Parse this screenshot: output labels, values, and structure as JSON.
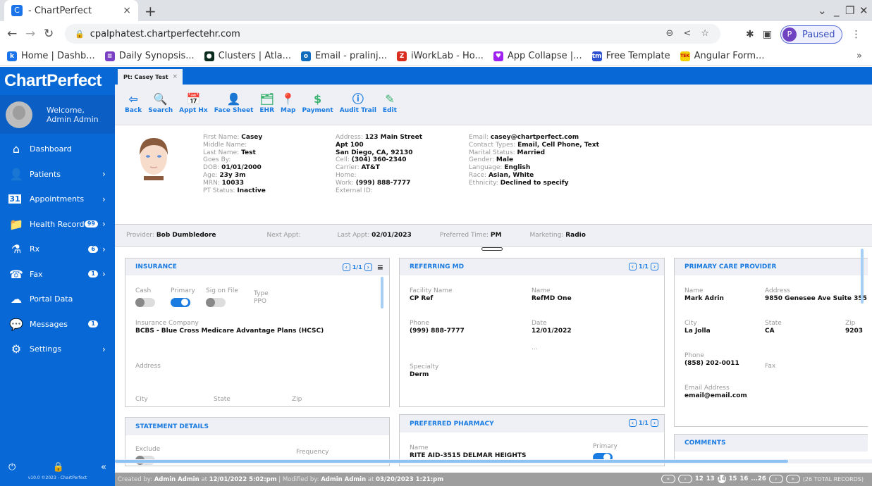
{
  "browser": {
    "tab_title": "- ChartPerfect",
    "url": "cpalphatest.chartperfectehr.com",
    "profile_label": "Paused",
    "profile_initial": "P",
    "bookmarks": [
      {
        "label": "Home | Dashb...",
        "color": "#1a73e8",
        "glyph": "k"
      },
      {
        "label": "Daily Synopsis...",
        "color": "#7b3fc4",
        "glyph": "≡"
      },
      {
        "label": "Clusters | Atla...",
        "color": "#0b2b1e",
        "glyph": "●"
      },
      {
        "label": "Email - pralinj...",
        "color": "#0f6cbd",
        "glyph": "o"
      },
      {
        "label": "iWorkLab - Ho...",
        "color": "#d92d20",
        "glyph": "Z"
      },
      {
        "label": "App Collapse |...",
        "color": "#a020f0",
        "glyph": "♥"
      },
      {
        "label": "Free Template",
        "color": "#2b4fcf",
        "glyph": "tm"
      },
      {
        "label": "Angular Form...",
        "color": "#f5d10a",
        "glyph": "TEK"
      }
    ]
  },
  "sidebar": {
    "brand": "ChartPerfect",
    "welcome_line1": "Welcome,",
    "welcome_line2": "Admin Admin",
    "items": [
      {
        "label": "Dashboard",
        "icon": "⌂",
        "badge": null,
        "chevron": false
      },
      {
        "label": "Patients",
        "icon": "👤",
        "badge": null,
        "chevron": true
      },
      {
        "label": "Appointments",
        "icon": "31",
        "badge": null,
        "chevron": true
      },
      {
        "label": "Health Record",
        "icon": "📁",
        "badge": "99",
        "chevron": true
      },
      {
        "label": "Rx",
        "icon": "⚗",
        "badge": "6",
        "chevron": true
      },
      {
        "label": "Fax",
        "icon": "☎",
        "badge": "1",
        "chevron": true
      },
      {
        "label": "Portal Data",
        "icon": "☁",
        "badge": null,
        "chevron": false
      },
      {
        "label": "Messages",
        "icon": "💬",
        "badge": "1",
        "chevron": false
      },
      {
        "label": "Settings",
        "icon": "⚙",
        "badge": null,
        "chevron": true
      }
    ],
    "version": "v10.0 ©2023 - ChartPerfect"
  },
  "patient_tab": {
    "label": "Pt: Casey Test",
    "close": "×"
  },
  "toolbar": [
    {
      "label": "Back",
      "icon": "⇦",
      "color": "#1a7be0"
    },
    {
      "label": "Search",
      "icon": "🔍",
      "color": "#1a7be0"
    },
    {
      "label": "Appt Hx",
      "icon": "📅",
      "color": "#f5a623"
    },
    {
      "label": "Face Sheet",
      "icon": "👤",
      "color": "#1a7be0"
    },
    {
      "label": "EHR",
      "icon": "🗂",
      "color": "#3cb371"
    },
    {
      "label": "Map",
      "icon": "📍",
      "color": "#1a7be0"
    },
    {
      "label": "Payment",
      "icon": "$",
      "color": "#3cb371"
    },
    {
      "label": "Audit Trail",
      "icon": "ⓘ",
      "color": "#1a7be0"
    },
    {
      "label": "Edit",
      "icon": "✎",
      "color": "#3cb371"
    }
  ],
  "patient": {
    "col1": [
      {
        "label": "First Name:",
        "value": "Casey"
      },
      {
        "label": "Middle Name:",
        "value": ""
      },
      {
        "label": "Last Name:",
        "value": "Test"
      },
      {
        "label": "Goes By:",
        "value": ""
      },
      {
        "label": "DOB:",
        "value": "01/01/2000"
      },
      {
        "label": "Age:",
        "value": "23y 3m"
      },
      {
        "label": "MRN:",
        "value": "10033"
      },
      {
        "label": "PT Status:",
        "value": "Inactive"
      }
    ],
    "col2": [
      {
        "label": "Address:",
        "value": "123 Main Street"
      },
      {
        "label": "",
        "value": "Apt 100"
      },
      {
        "label": "",
        "value": "San Diego, CA, 92130"
      },
      {
        "label": "Cell:",
        "value": "(304) 360-2340"
      },
      {
        "label": "Carrier:",
        "value": "AT&T"
      },
      {
        "label": "Home:",
        "value": ""
      },
      {
        "label": "Work:",
        "value": "(999) 888-7777"
      },
      {
        "label": "External ID:",
        "value": ""
      }
    ],
    "col3": [
      {
        "label": "Email:",
        "value": "casey@chartperfect.com"
      },
      {
        "label": "Contact Types:",
        "value": "Email, Cell Phone, Text"
      },
      {
        "label": "Marital Status:",
        "value": "Married"
      },
      {
        "label": "Gender:",
        "value": "Male"
      },
      {
        "label": "Language:",
        "value": "English"
      },
      {
        "label": "Race:",
        "value": "Asian, White"
      },
      {
        "label": "Ethnicity:",
        "value": "Declined to specify"
      }
    ]
  },
  "summary": [
    {
      "label": "Provider:",
      "value": "Bob Dumbledore"
    },
    {
      "label": "Next Appt:",
      "value": ""
    },
    {
      "label": "Last Appt:",
      "value": "02/01/2023"
    },
    {
      "label": "Preferred Time:",
      "value": "PM"
    },
    {
      "label": "Marketing:",
      "value": "Radio"
    }
  ],
  "insurance": {
    "title": "INSURANCE",
    "pager": "1/1",
    "cash_label": "Cash",
    "cash_on": false,
    "primary_label": "Primary",
    "primary_on": true,
    "sig_label": "Sig on File",
    "sig_on": false,
    "type_label": "Type",
    "type_value": "PPO",
    "company_label": "Insurance Company",
    "company_value": "BCBS - Blue Cross Medicare Advantage Plans (HCSC)",
    "address_label": "Address",
    "city_label": "City",
    "state_label": "State",
    "zip_label": "Zip"
  },
  "referring": {
    "title": "REFERRING MD",
    "pager": "1/1",
    "facility_label": "Facility Name",
    "facility_value": "CP Ref",
    "name_label": "Name",
    "name_value": "RefMD One",
    "phone_label": "Phone",
    "phone_value": "(999) 888-7777",
    "date_label": "Date",
    "date_value": "12/01/2022",
    "ellipsis": "...",
    "specialty_label": "Specialty",
    "specialty_value": "Derm"
  },
  "pcp": {
    "title": "PRIMARY CARE PROVIDER",
    "name_label": "Name",
    "name_value": "Mark Adrin",
    "address_label": "Address",
    "address_value": "9850 Genesee Ave Suite 355",
    "city_label": "City",
    "city_value": "La Jolla",
    "state_label": "State",
    "state_value": "CA",
    "zip_label": "Zip",
    "zip_value": "9203",
    "phone_label": "Phone",
    "phone_value": "(858) 202-0011",
    "fax_label": "Fax",
    "email_label": "Email Address",
    "email_value": "email@email.com"
  },
  "statement": {
    "title": "STATEMENT DETAILS",
    "exclude_label": "Exclude",
    "frequency_label": "Frequency"
  },
  "pharmacy": {
    "title": "PREFERRED PHARMACY",
    "pager": "1/1",
    "name_label": "Name",
    "name_value": "RITE AID-3515 DELMAR HEIGHTS",
    "primary_label": "Primary",
    "primary_on": true
  },
  "comments": {
    "title": "COMMENTS"
  },
  "status": {
    "created_prefix": "Created by:",
    "created_by": "Admin Admin",
    "at1": "at",
    "created_at": "12/01/2022 5:02:pm",
    "sep": "|",
    "modified_prefix": "Modified by:",
    "modified_by": "Admin Admin",
    "at2": "at",
    "modified_at": "03/20/2023 1:21:pm",
    "pages": [
      "12",
      "13",
      "14",
      "15",
      "16",
      "...26"
    ],
    "current_page": "14",
    "total": "(26 TOTAL RECORDS)"
  }
}
